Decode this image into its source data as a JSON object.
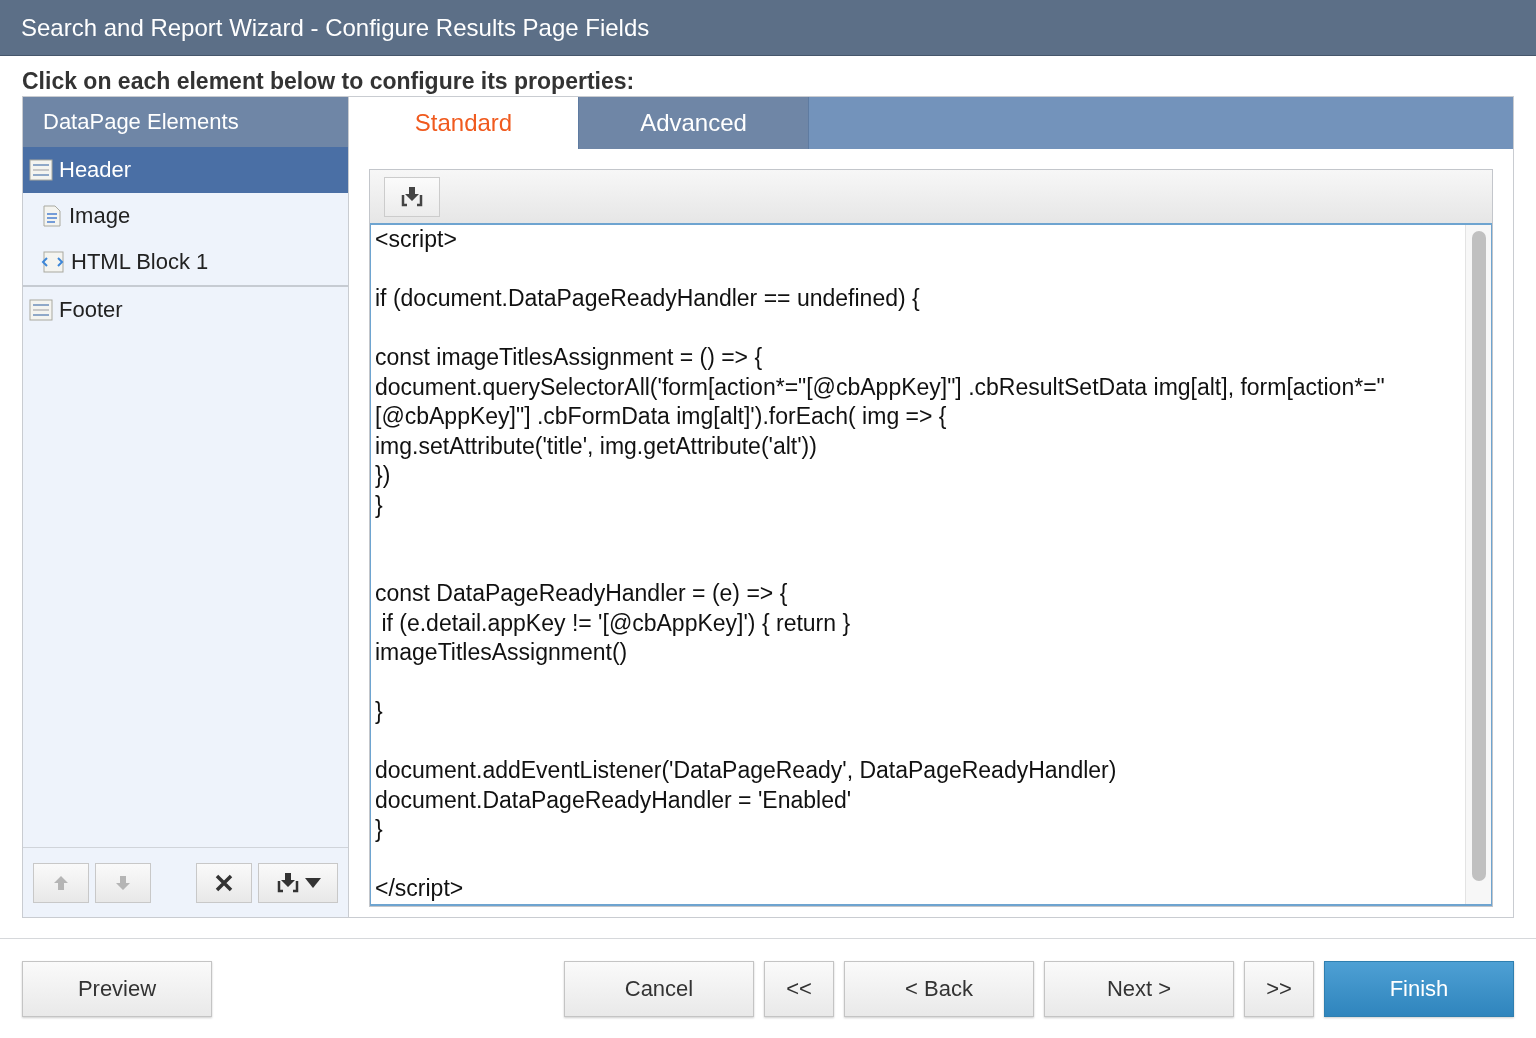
{
  "window": {
    "title": "Search and Report Wizard - Configure Results Page Fields"
  },
  "instruction": "Click on each element below to configure its properties:",
  "sidebar": {
    "title": "DataPage Elements",
    "items": [
      {
        "label": "Header",
        "kind": "section",
        "selected": true,
        "children": [
          {
            "label": "Image",
            "kind": "text",
            "selected": false
          },
          {
            "label": "HTML Block 1",
            "kind": "html",
            "selected": false
          }
        ]
      },
      {
        "label": "Footer",
        "kind": "section",
        "selected": false
      }
    ],
    "toolbar": [
      {
        "kind": "up",
        "disabled": true
      },
      {
        "kind": "down",
        "disabled": true
      },
      {
        "kind": "delete",
        "disabled": false
      },
      {
        "kind": "insert",
        "disabled": false
      }
    ]
  },
  "tabs": [
    {
      "label": "Standard",
      "selected": true
    },
    {
      "label": "Advanced",
      "selected": false
    }
  ],
  "editor": {
    "value": "<script>\n\nif (document.DataPageReadyHandler == undefined) {\n\nconst imageTitlesAssignment = () => {\ndocument.querySelectorAll('form[action*=\"[@cbAppKey]\"] .cbResultSetData img[alt], form[action*=\"\n[@cbAppKey]\"] .cbFormData img[alt]').forEach( img => {\nimg.setAttribute('title', img.getAttribute('alt'))\n})\n}\n\n\nconst DataPageReadyHandler = (e) => {\n if (e.detail.appKey != '[@cbAppKey]') { return }\nimageTitlesAssignment()\n\n}\n\ndocument.addEventListener('DataPageReady', DataPageReadyHandler)\ndocument.DataPageReadyHandler = 'Enabled'\n}\n\n</script>"
  },
  "buttons": [
    {
      "label": "Preview",
      "kind": "normal"
    },
    {
      "label": "Cancel",
      "kind": "normal"
    },
    {
      "label": "<<",
      "kind": "small"
    },
    {
      "label": "< Back",
      "kind": "normal"
    },
    {
      "label": "Next >",
      "kind": "normal"
    },
    {
      "label": ">>",
      "kind": "small"
    },
    {
      "label": "Finish",
      "kind": "primary"
    }
  ]
}
